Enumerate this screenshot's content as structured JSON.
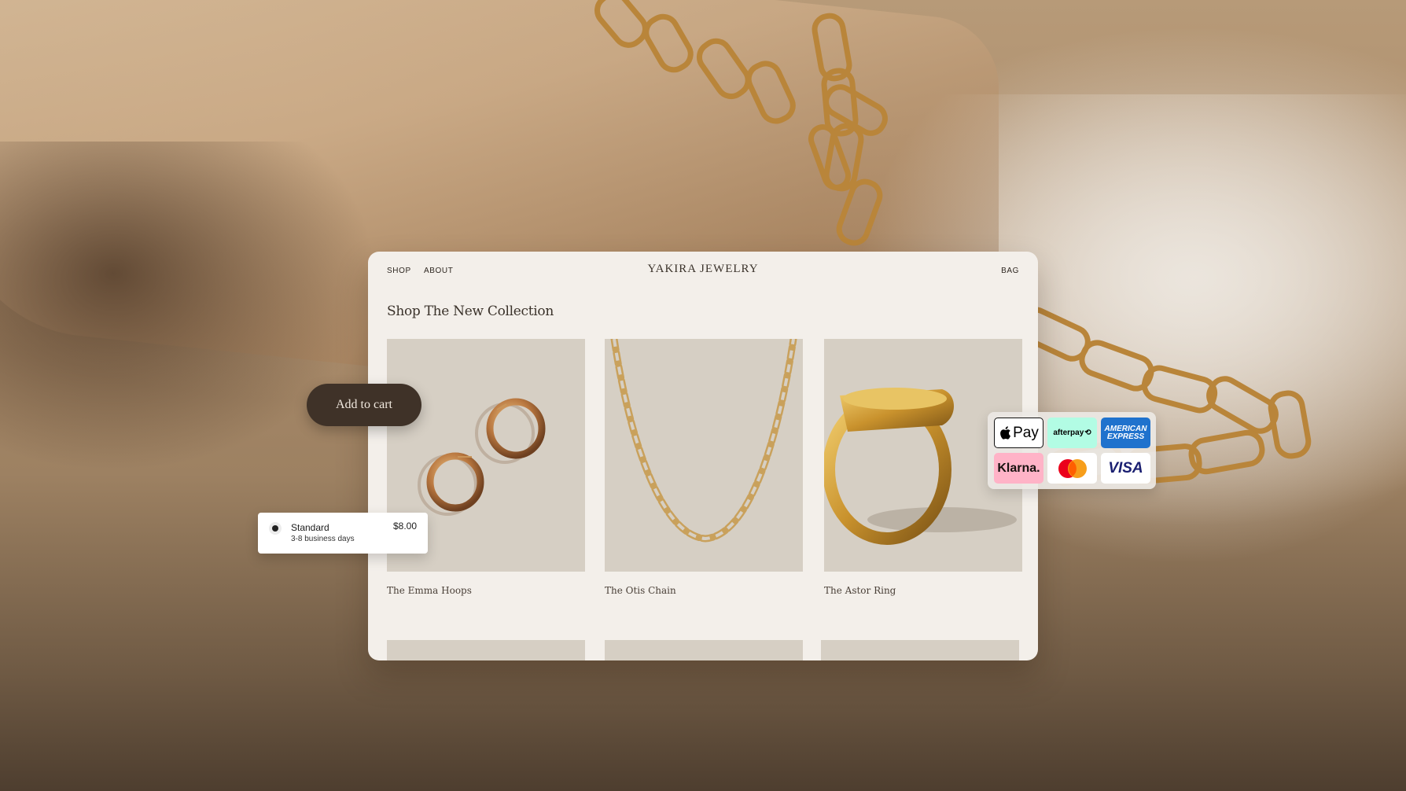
{
  "nav": {
    "shop_label": "SHOP",
    "about_label": "ABOUT",
    "brand": "YAKIRA JEWELRY",
    "bag_label": "BAG"
  },
  "page": {
    "title": "Shop The New Collection"
  },
  "products": [
    {
      "name": "The Emma Hoops",
      "image": "gold-hoop-earrings"
    },
    {
      "name": "The Otis Chain",
      "image": "gold-paperclip-chain"
    },
    {
      "name": "The Astor Ring",
      "image": "gold-signet-ring"
    }
  ],
  "add_to_cart": {
    "label": "Add to cart"
  },
  "shipping": {
    "name": "Standard",
    "detail": "3-8 business days",
    "price": "$8.00"
  },
  "payment_methods": [
    {
      "name": "Apple Pay",
      "label": "Pay",
      "bg": "#ffffff",
      "fg": "#000000"
    },
    {
      "name": "Afterpay",
      "label": "afterpay",
      "bg": "#b2fce4",
      "fg": "#000000"
    },
    {
      "name": "American Express",
      "label": "AMERICAN EXPRESS",
      "bg": "#1f72cd",
      "fg": "#ffffff"
    },
    {
      "name": "Klarna",
      "label": "Klarna.",
      "bg": "#ffb3c7",
      "fg": "#17120f"
    },
    {
      "name": "Mastercard",
      "label": "",
      "bg": "#ffffff",
      "fg": "#000000"
    },
    {
      "name": "Visa",
      "label": "VISA",
      "bg": "#ffffff",
      "fg": "#1a1f71"
    }
  ],
  "colors": {
    "window_bg": "#f3efea",
    "card_bg": "#d6cfc4",
    "button_bg": "#3f3228",
    "gold": "#c9963f"
  }
}
